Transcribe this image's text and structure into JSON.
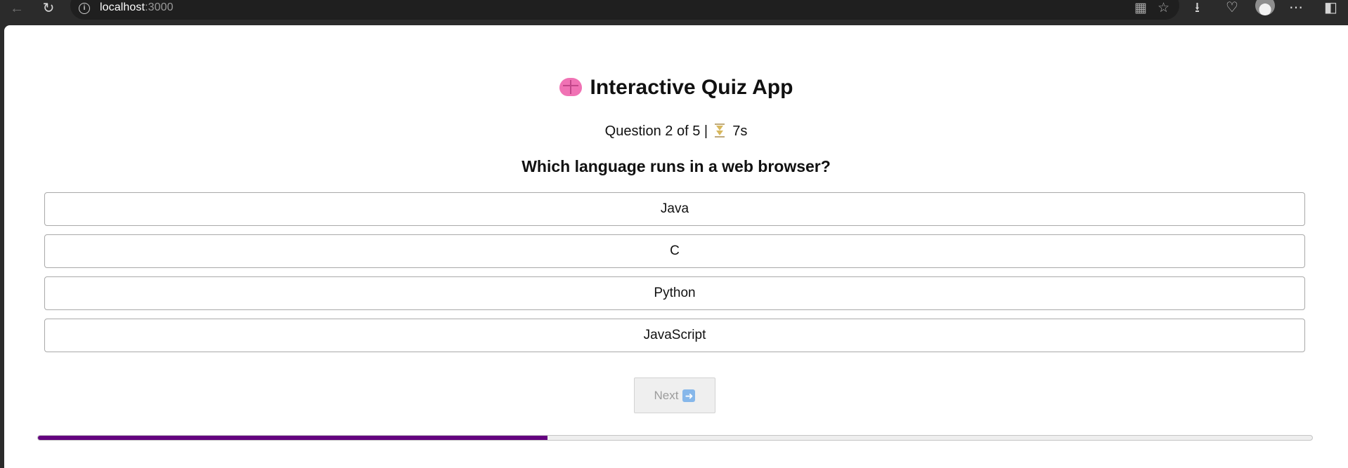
{
  "browser": {
    "url_host": "localhost",
    "url_port": ":3000",
    "icons": [
      "back-arrow-icon",
      "refresh-icon",
      "info-icon",
      "split-view-icon",
      "favorite-star-icon",
      "download-icon",
      "health-icon",
      "profile-avatar",
      "more-icon",
      "sidebar-icon"
    ]
  },
  "app": {
    "title": "Interactive Quiz App",
    "title_icon": "brain-icon"
  },
  "quiz": {
    "question_status": "Question 2 of 5 |",
    "timer_icon": "hourglass-icon",
    "time_left": "7s",
    "question": "Which language runs in a web browser?",
    "options": [
      "Java",
      "C",
      "Python",
      "JavaScript"
    ],
    "next_label": "Next",
    "next_icon": "right-arrow-icon",
    "progress_fraction": 0.4
  },
  "colors": {
    "progress_fill": "#64027f",
    "page_background": "#ffffff",
    "browser_background": "#2b2b2b"
  }
}
